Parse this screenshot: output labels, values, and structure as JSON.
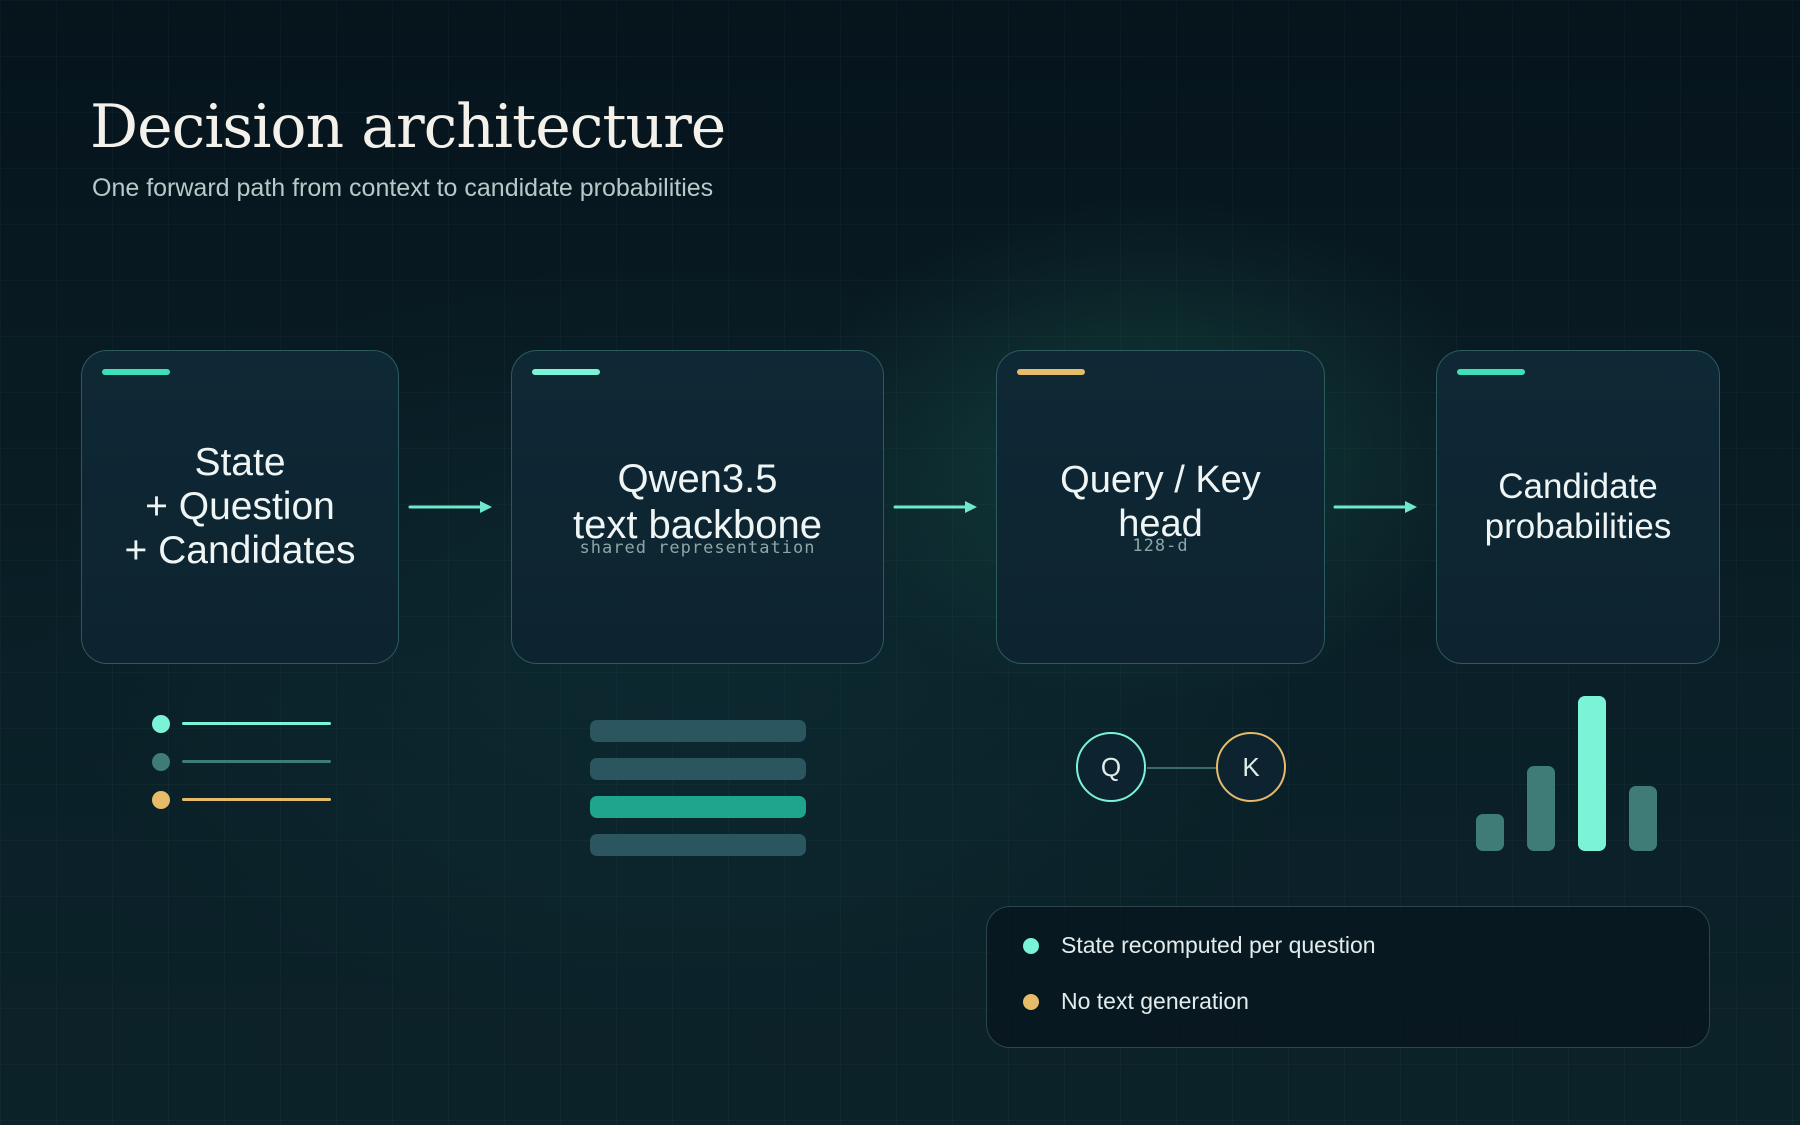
{
  "title": "Decision architecture",
  "subtitle": "One forward path from context to candidate probabilities",
  "colors": {
    "teal": "#3fe0b8",
    "mint": "#7af3d6",
    "gold": "#e6bc6a",
    "muted_teal": "#3f7c78",
    "card_border": "#2c5a5e"
  },
  "stages": [
    {
      "label": "State\n+ Question\n+ Candidates",
      "sub": "",
      "accent": "#3fe0b8"
    },
    {
      "label": "Qwen3.5\ntext backbone",
      "sub": "shared representation",
      "accent": "#7af3d6"
    },
    {
      "label": "Query / Key\nhead",
      "sub": "128-d",
      "accent": "#e6bc6a"
    },
    {
      "label": "Candidate\nprobabilities",
      "sub": "",
      "accent": "#3fe0b8"
    }
  ],
  "qk": {
    "q": "Q",
    "k": "K"
  },
  "probability_bars": [
    0.24,
    0.55,
    1.0,
    0.42
  ],
  "legend": [
    {
      "text": "State recomputed per question",
      "color": "#7af3d6"
    },
    {
      "text": "No text generation",
      "color": "#e6bc6a"
    }
  ]
}
